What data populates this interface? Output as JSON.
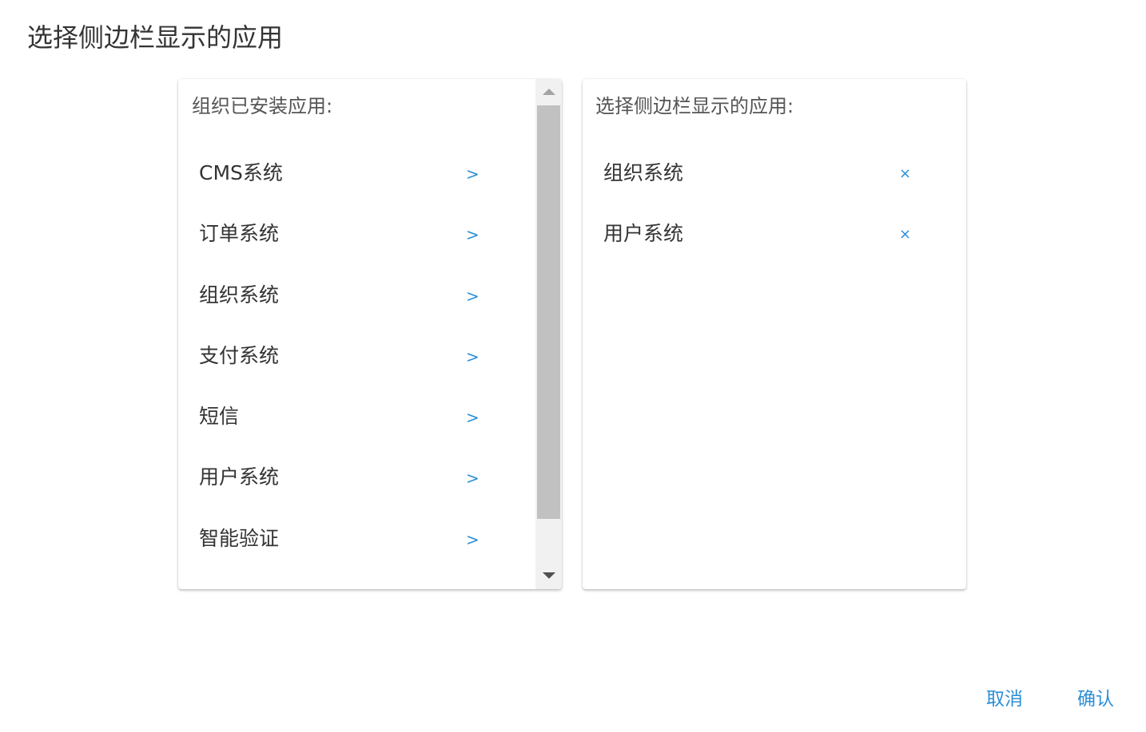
{
  "dialog": {
    "title": "选择侧边栏显示的应用"
  },
  "installed_panel": {
    "header": "组织已安装应用:",
    "add_symbol": ">",
    "items": [
      {
        "label": "CMS系统"
      },
      {
        "label": "订单系统"
      },
      {
        "label": "组织系统"
      },
      {
        "label": "支付系统"
      },
      {
        "label": "短信"
      },
      {
        "label": "用户系统"
      },
      {
        "label": "智能验证"
      }
    ]
  },
  "selected_panel": {
    "header": "选择侧边栏显示的应用:",
    "remove_symbol": "×",
    "items": [
      {
        "label": "组织系统"
      },
      {
        "label": "用户系统"
      }
    ]
  },
  "footer": {
    "cancel_label": "取消",
    "confirm_label": "确认"
  },
  "colors": {
    "accent": "#2b8fd6",
    "text": "#333333",
    "scroll_thumb": "#c1c1c1",
    "scroll_track": "#f1f1f1"
  }
}
